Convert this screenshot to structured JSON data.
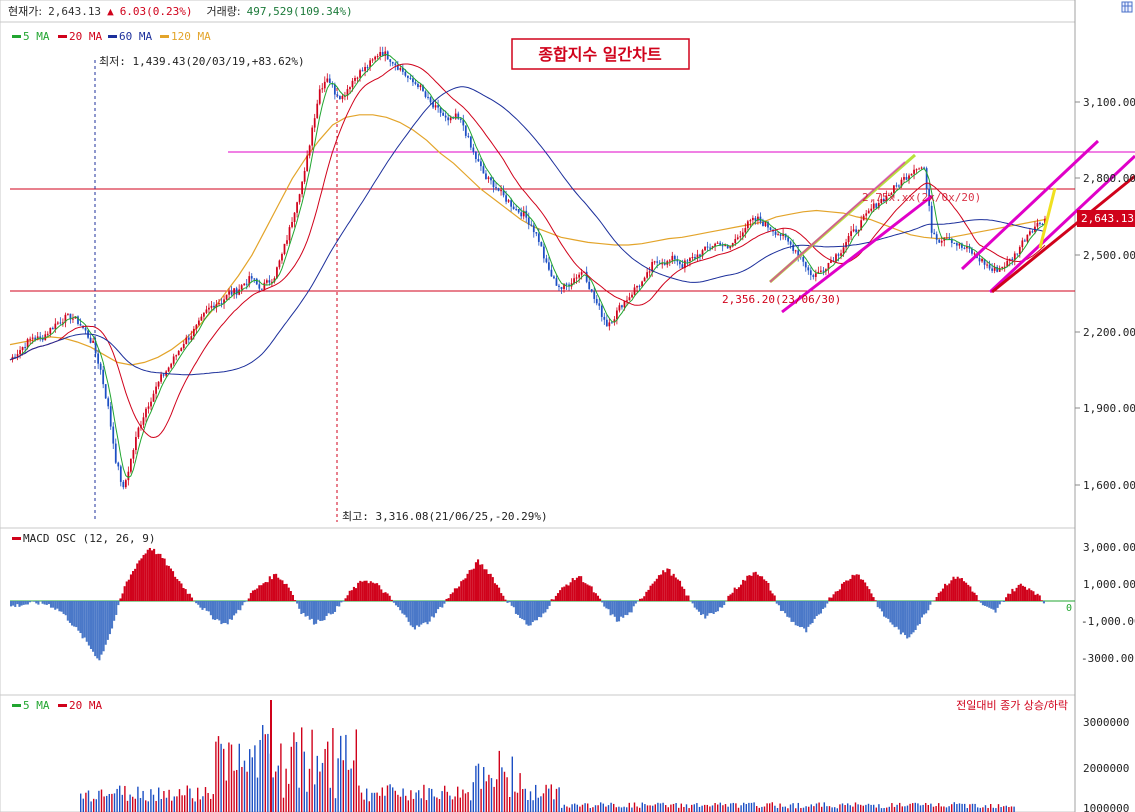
{
  "header": {
    "price_label": "현재가:",
    "price": "2,643.13",
    "change_icon": "up-triangle-icon",
    "change": "6.03(0.23%)",
    "volume_label": "거래량:",
    "volume": "497,529(109.34%)"
  },
  "scrollbar_icon": "grid-icon",
  "colors": {
    "up": "#d0021b",
    "down": "#1c4fc4",
    "ma5": "#21a530",
    "ma20": "#d0021b",
    "ma60": "#1c2f9b",
    "ma120": "#e3a42a",
    "osc_up": "#d0021b",
    "osc_down": "#4a78c8",
    "pink": "#e000c8",
    "lime": "#b8e03c",
    "yellow": "#f0e020"
  },
  "price_panel": {
    "title": "종합지수 일간차트",
    "legend": [
      "5 MA",
      "20 MA",
      "60 MA",
      "120 MA"
    ],
    "y_ticks": [
      "3,100.00",
      "2,800.00",
      "2,500.00",
      "2,200.00",
      "1,900.00",
      "1,600.00"
    ],
    "current_tag": "2,643.13",
    "annotations": {
      "low": "최저: 1,439.43(20/03/19,+83.62%)",
      "high": "최고: 3,316.08(21/06/25,-20.29%)",
      "support": "2,356.20(23/06/30)",
      "mid": "2,75x.xx(2x/0x/20)"
    }
  },
  "macd_panel": {
    "legend": "MACD OSC (12, 26, 9)",
    "y_ticks": [
      "3,000.00",
      "1,000.00",
      "-1,000.00",
      "-3000.00"
    ],
    "zero_label": "0"
  },
  "volume_panel": {
    "legend": [
      "5 MA",
      "20 MA"
    ],
    "note": "전일대비 종가 상승/하락",
    "y_ticks": [
      "3000000",
      "2000000",
      "1000000"
    ]
  },
  "chart_data": {
    "type": "candlestick",
    "title": "종합지수 일간차트",
    "current": 2643.13,
    "low": {
      "value": 1439.43,
      "date": "20/03/19"
    },
    "high": {
      "value": 3316.08,
      "date": "21/06/25"
    },
    "support": {
      "value": 2356.2,
      "date": "23/06/30"
    },
    "ylim": [
      1600,
      3100
    ],
    "hlines": [
      2950,
      2830,
      2370
    ],
    "close": [
      2090,
      2120,
      2150,
      2180,
      2170,
      2200,
      2230,
      2250,
      2260,
      2240,
      2200,
      2150,
      2050,
      1900,
      1700,
      1580,
      1700,
      1820,
      1900,
      1960,
      2020,
      2060,
      2110,
      2160,
      2190,
      2230,
      2280,
      2310,
      2320,
      2350,
      2360,
      2390,
      2410,
      2370,
      2390,
      2420,
      2500,
      2600,
      2720,
      2820,
      3000,
      3150,
      3200,
      3140,
      3120,
      3170,
      3210,
      3230,
      3260,
      3300,
      3280,
      3250,
      3220,
      3180,
      3170,
      3120,
      3080,
      3060,
      3020,
      3040,
      3010,
      2920,
      2860,
      2800,
      2780,
      2740,
      2710,
      2680,
      2660,
      2620,
      2560,
      2460,
      2400,
      2370,
      2390,
      2420,
      2440,
      2350,
      2290,
      2230,
      2260,
      2310,
      2340,
      2380,
      2400,
      2460,
      2480,
      2470,
      2490,
      2460,
      2480,
      2500,
      2520,
      2540,
      2550,
      2520,
      2560,
      2600,
      2630,
      2640,
      2620,
      2600,
      2580,
      2550,
      2520,
      2480,
      2420,
      2430,
      2460,
      2490,
      2520,
      2570,
      2600,
      2640,
      2680,
      2710,
      2730,
      2760,
      2790,
      2820,
      2850,
      2840,
      2600,
      2560,
      2580,
      2550,
      2530,
      2520,
      2490,
      2470,
      2440,
      2450,
      2470,
      2500,
      2550,
      2600,
      2620,
      2643.13
    ],
    "ma120": [
      2150,
      2160,
      2170,
      2180,
      2175,
      2160,
      2140,
      2110,
      2080,
      2070,
      2080,
      2100,
      2130,
      2170,
      2220,
      2280,
      2350,
      2420,
      2500,
      2600,
      2700,
      2800,
      2880,
      2950,
      3010,
      3040,
      3050,
      3050,
      3040,
      3020,
      2990,
      2950,
      2900,
      2860,
      2810,
      2760,
      2720,
      2680,
      2640,
      2610,
      2590,
      2570,
      2560,
      2550,
      2545,
      2540,
      2540,
      2545,
      2555,
      2565,
      2570,
      2580,
      2590,
      2600,
      2610,
      2620,
      2630,
      2650,
      2660,
      2670,
      2675,
      2670,
      2665,
      2650,
      2640,
      2620,
      2600,
      2580,
      2570,
      2565,
      2570,
      2580,
      2590,
      2600,
      2610,
      2620,
      2630,
      2640
    ],
    "macd_osc": [
      -300,
      -200,
      -100,
      -200,
      -600,
      -1400,
      -2300,
      -3300,
      -1500,
      800,
      2100,
      3000,
      2400,
      1400,
      500,
      -300,
      -900,
      -1300,
      -600,
      400,
      1000,
      1500,
      800,
      -600,
      -1200,
      -900,
      -300,
      600,
      1200,
      900,
      200,
      -700,
      -1500,
      -1200,
      -400,
      500,
      1300,
      2200,
      1500,
      300,
      -600,
      -1400,
      -900,
      200,
      900,
      1400,
      700,
      -300,
      -1100,
      -700,
      200,
      1200,
      1800,
      1000,
      -200,
      -900,
      -600,
      400,
      1100,
      1700,
      900,
      -500,
      -1200,
      -1700,
      -800,
      300,
      1000,
      1600,
      700,
      -700,
      -1400,
      -2100,
      -1200,
      0,
      900,
      1400,
      800,
      -300,
      -600,
      400,
      900,
      600,
      -200
    ]
  }
}
